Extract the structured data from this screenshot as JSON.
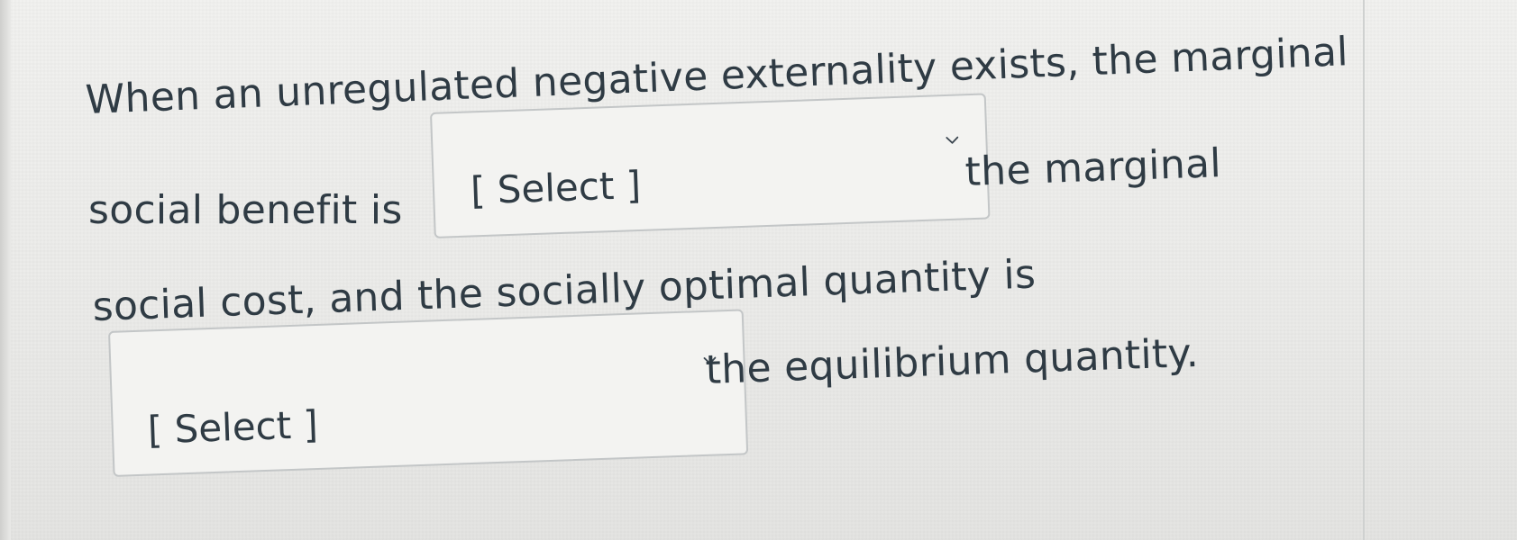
{
  "question": {
    "line1": "When an unregulated negative externality exists, the marginal",
    "line2": "social benefit is",
    "line3": "the marginal",
    "line4": "social cost, and the socially optimal quantity is",
    "line5": "the equilibrium quantity."
  },
  "selects": [
    {
      "value": "[ Select ]",
      "icon": "chevron-down-icon"
    },
    {
      "value": "[ Select ]",
      "icon": "chevron-down-icon"
    }
  ]
}
